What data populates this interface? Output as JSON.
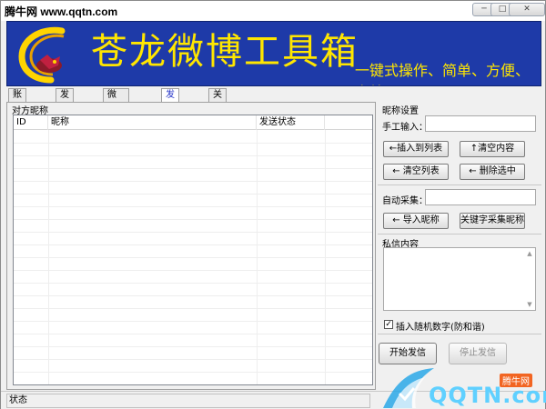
{
  "watermark": {
    "text": "腾牛网 www.qqtn.com"
  },
  "window_controls": {
    "minimize": "─",
    "maximize": "□",
    "close": "✕"
  },
  "banner": {
    "title": "苍龙微博工具箱",
    "slogan": "一键式操作、简单、方便、高效",
    "logo": "dragon-logo",
    "colors": {
      "background": "#1e3aa8",
      "text": "#ffe600"
    }
  },
  "tabs": [
    {
      "label": "账号管理"
    },
    {
      "label": "发表微博"
    },
    {
      "label": "微博评论Add"
    },
    {
      "label": "发送私信",
      "active": true
    },
    {
      "label": "关于"
    }
  ],
  "left": {
    "group_label": "对方昵称",
    "columns": [
      "ID",
      "昵称",
      "发送状态"
    ]
  },
  "right": {
    "nickname_settings": {
      "label": "昵称设置",
      "manual_input_label": "手工输入：",
      "manual_input_value": "",
      "insert_to_list": "←插入到列表",
      "clear_content": "↑清空内容",
      "clear_list": "←  清空列表",
      "delete_selected": "←  删除选中"
    },
    "auto_collect": {
      "label": "自动采集：",
      "value": "",
      "import_nickname": "←  导入昵称",
      "keyword_collect": "关键字采集昵称"
    },
    "message": {
      "label": "私信内容",
      "value": "",
      "insert_random": "插入随机数字(防和谐)",
      "insert_random_checked": true
    },
    "actions": {
      "start": "开始发信",
      "stop": "停止发信"
    }
  },
  "status": {
    "label": "状态"
  },
  "corner_watermark": {
    "text": "QQTN.com",
    "badge": "腾牛网",
    "accent": "#5fd0ff"
  }
}
